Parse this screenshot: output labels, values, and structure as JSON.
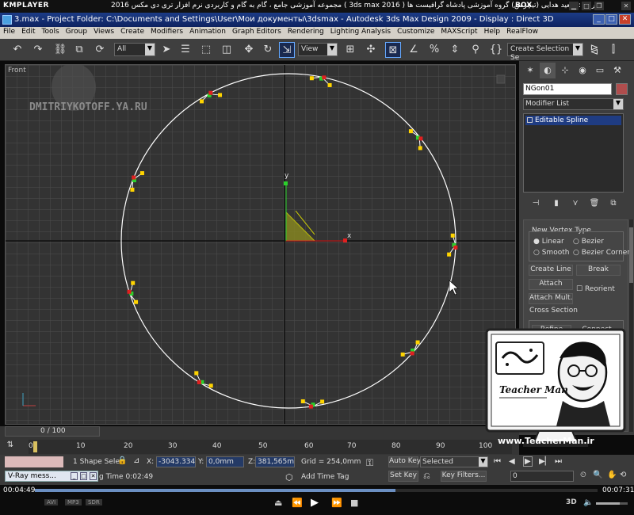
{
  "kmplayer": {
    "logo": "KMPLAYER",
    "title": "مجموعه آموزشی جامع ، گام به گام و کاربردی نرم افزار تری دی مکس 2016 ( 3ds max 2016 ) مدرس : سعید هدایی (تیچرمن) گروه آموزشی پادشاه گرافیست ها",
    "box_label": "BOX"
  },
  "window": {
    "title": "3.max  - Project Folder: C:\\Documents and Settings\\User\\Мои документы\\3dsmax      - Autodesk 3ds Max Design 2009       - Display : Direct 3D"
  },
  "menu": [
    "File",
    "Edit",
    "Tools",
    "Group",
    "Views",
    "Create",
    "Modifiers",
    "Animation",
    "Graph Editors",
    "Rendering",
    "Lighting Analysis",
    "Customize",
    "MAXScript",
    "Help",
    "RealFlow"
  ],
  "toolbar": {
    "selection_filter": "All",
    "ref_coord": "View",
    "named_selection": "Create Selection Se"
  },
  "viewport": {
    "label": "Front",
    "watermark": "DMITRIYKOTOFF.YA.RU",
    "axis_y": "y",
    "axis_x": "x"
  },
  "command_panel": {
    "object_name": "NGon01",
    "modifier_list": "Modifier List",
    "stack_item": "Editable Spline",
    "vertex_type_label": "New Vertex Type",
    "linear": "Linear",
    "bezier": "Bezier",
    "smooth": "Smooth",
    "bezier_corner": "Bezier Corner",
    "create_line": "Create Line",
    "break": "Break",
    "attach": "Attach",
    "reorient": "Reorient",
    "attach_mult": "Attach Mult.",
    "cross_section": "Cross Section",
    "refine": "Refine",
    "connect": "Connect"
  },
  "timeline": {
    "frame_display": "0 / 100",
    "ticks": [
      "0",
      "10",
      "20",
      "30",
      "40",
      "50",
      "60",
      "70",
      "80",
      "90",
      "100"
    ]
  },
  "status": {
    "selection": "1 Shape Sele",
    "x_label": "X:",
    "x_value": "-3043.334",
    "y_label": "Y:",
    "y_value": "0,0mm",
    "z_label": "Z:",
    "z_value": "381,565m",
    "grid": "Grid = 254,0mm",
    "auto_key": "Auto Key",
    "selected": "Selected",
    "set_key": "Set Key",
    "key_filters": "Key Filters...",
    "frame": "0",
    "add_time_tag": "Add Time Tag",
    "vray_msg": "V-Ray mess...",
    "time": "g Time  0:02:49"
  },
  "player": {
    "elapsed": "00:04:49",
    "total": "00:07:31",
    "badges": [
      "AVI",
      "MP3",
      "SDR"
    ]
  },
  "overlay": {
    "brand": "Teacher Man",
    "site": "www.TeacherMan.ir"
  },
  "colors": {
    "grid_bg": "#333333",
    "spline": "#ffffff",
    "vertex_yellow": "#ffd400",
    "vertex_green": "#2bd02b",
    "vertex_red": "#e02020",
    "title_blue": "#1c3c86"
  }
}
